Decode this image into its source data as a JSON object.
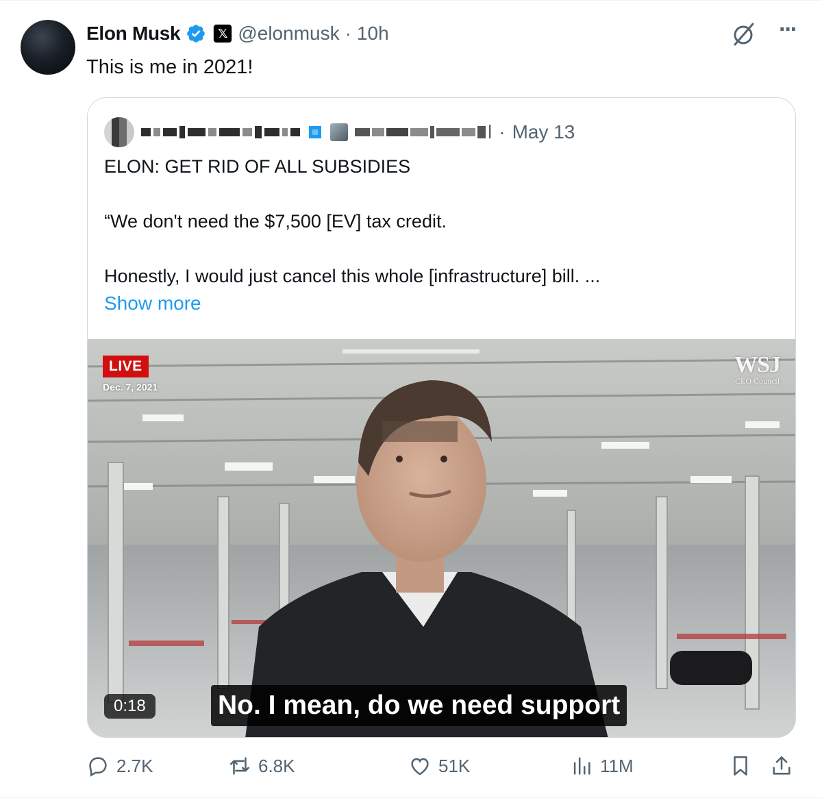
{
  "author": {
    "name": "Elon Musk",
    "handle": "@elonmusk",
    "separator": "·",
    "time": "10h",
    "verified_color": "#1d9bf0",
    "affiliation_badge": "𝕏"
  },
  "tweet_text": "This is me in 2021!",
  "quoted": {
    "date_separator": "·",
    "date": "May 13",
    "headline": "ELON: GET RID OF ALL SUBSIDIES",
    "line2": "“We don't need the $7,500 [EV] tax credit.",
    "line3": "Honestly, I would just cancel this whole [infrastructure] bill. ...",
    "show_more": "Show more",
    "handle_tail": "l",
    "video": {
      "live_label": "LIVE",
      "date_overlay": "Dec. 7, 2021",
      "brand": "WSJ",
      "brand_sub": "CEO Council",
      "duration": "0:18",
      "caption": "No. I mean, do we need support"
    }
  },
  "stats": {
    "replies": "2.7K",
    "retweets": "6.8K",
    "likes": "51K",
    "views": "11M"
  },
  "icons": {
    "more": "more-icon",
    "grok": "grok-icon",
    "reply": "reply-icon",
    "retweet": "retweet-icon",
    "like": "heart-icon",
    "views": "views-icon",
    "bookmark": "bookmark-icon",
    "share": "share-icon"
  },
  "colors": {
    "text": "#0f1419",
    "muted": "#536471",
    "link": "#1d9bf0",
    "live": "#d10f0f"
  }
}
